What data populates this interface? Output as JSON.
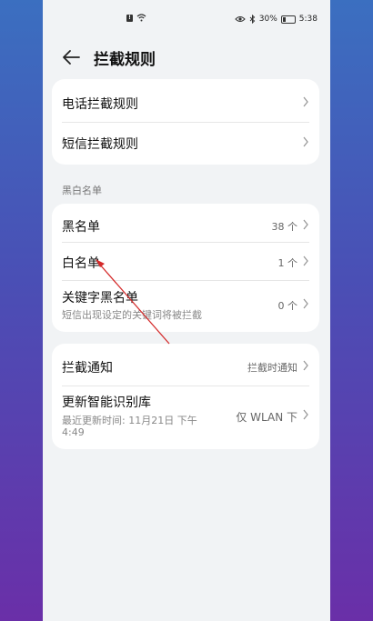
{
  "status_bar": {
    "battery": "30%",
    "time": "5:38",
    "icons": [
      "alert-icon",
      "wifi-icon",
      "eye-icon",
      "bluetooth-icon",
      "battery-icon"
    ]
  },
  "header": {
    "title": "拦截规则"
  },
  "card1": {
    "call_rules": "电话拦截规则",
    "sms_rules": "短信拦截规则"
  },
  "section": {
    "title": "黑白名单"
  },
  "card2": {
    "blacklist": {
      "label": "黑名单",
      "value": "38 个"
    },
    "whitelist": {
      "label": "白名单",
      "value": "1 个"
    },
    "keyword": {
      "label": "关键字黑名单",
      "sub": "短信出现设定的关键词将被拦截",
      "value": "0 个"
    }
  },
  "card3": {
    "notify": {
      "label": "拦截通知",
      "value": "拦截时通知"
    },
    "update": {
      "label": "更新智能识别库",
      "sub_line1": "最近更新时间: 11月21日 下午",
      "sub_line2": "4:49",
      "value": "仅 WLAN 下"
    }
  },
  "colors": {
    "annotation_arrow": "#d42a2a",
    "card_bg": "#ffffff",
    "page_bg": "#f1f3f5"
  }
}
